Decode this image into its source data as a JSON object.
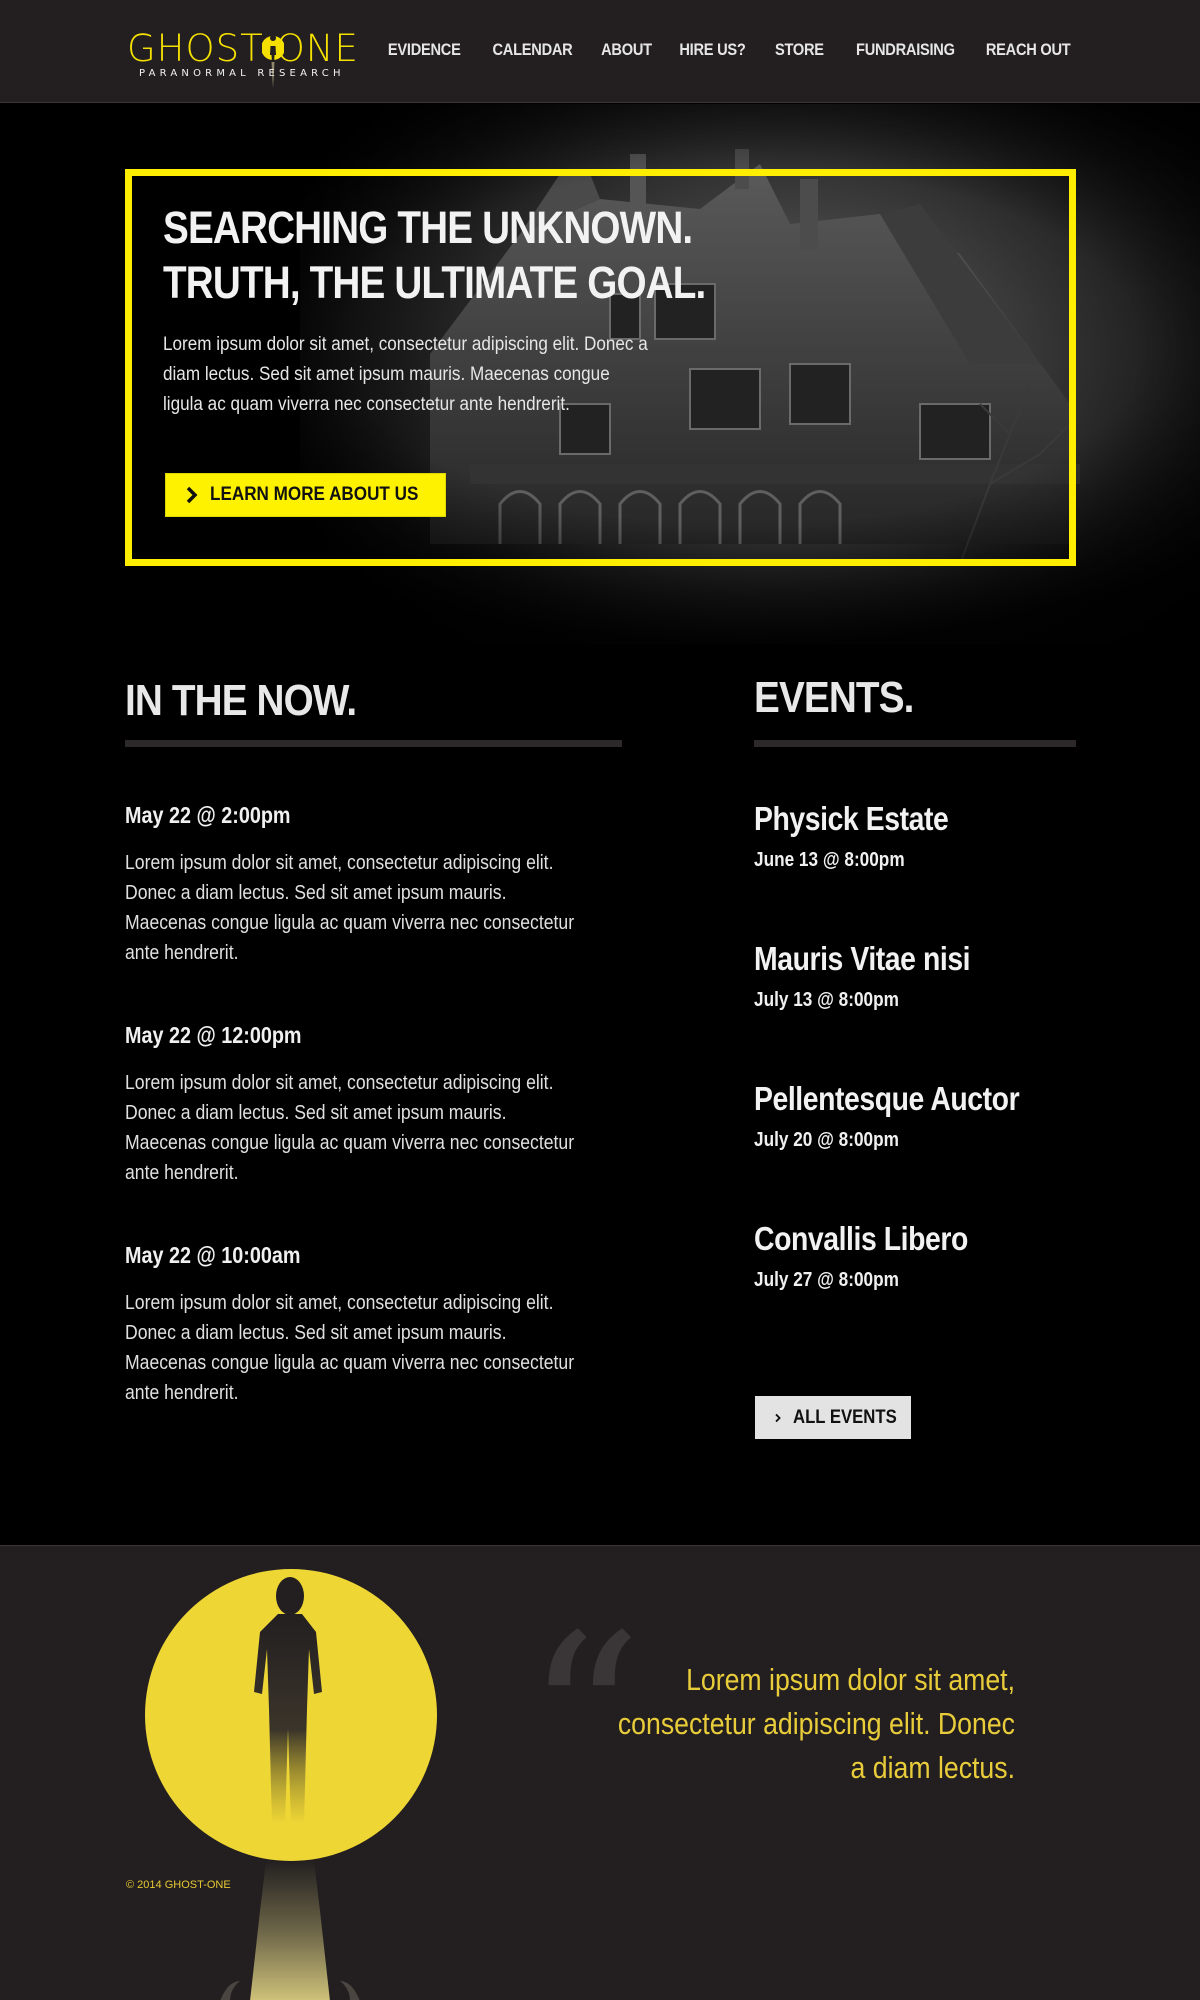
{
  "brand": {
    "name": "GHOST-ONE",
    "tagline": "PARANORMAL RESEARCH",
    "accent_color": "#fff200",
    "footer_moon_color": "#eed635",
    "background_color": "#000000",
    "bar_color": "#231f20"
  },
  "nav": {
    "items": [
      "EVIDENCE",
      "CALENDAR",
      "ABOUT",
      "HIRE US?",
      "STORE",
      "FUNDRAISING",
      "REACH OUT"
    ]
  },
  "hero": {
    "title_line1": "SEARCHING THE UNKNOWN.",
    "title_line2": "TRUTH, THE ULTIMATE GOAL.",
    "text": "Lorem ipsum dolor sit amet, consectetur adipiscing elit. Donec a diam lectus. Sed sit amet ipsum mauris. Maecenas congue ligula ac quam viverra nec consectetur ante hendrerit.",
    "button_label": "LEARN MORE  ABOUT US"
  },
  "now": {
    "title": "IN THE NOW.",
    "items": [
      {
        "date": "May 22 @ 2:00pm",
        "text": "Lorem ipsum dolor sit amet, consectetur adipiscing elit. Donec a diam lectus. Sed sit amet ipsum mauris. Maecenas congue ligula ac quam viverra nec consectetur ante hendrerit."
      },
      {
        "date": "May 22 @ 12:00pm",
        "text": "Lorem ipsum dolor sit amet, consectetur adipiscing elit. Donec a diam lectus. Sed sit amet ipsum mauris. Maecenas congue ligula ac quam viverra nec consectetur ante hendrerit."
      },
      {
        "date": "May 22 @ 10:00am",
        "text": "Lorem ipsum dolor sit amet, consectetur adipiscing elit. Donec a diam lectus. Sed sit amet ipsum mauris. Maecenas congue ligula ac quam viverra nec consectetur ante hendrerit."
      }
    ]
  },
  "events": {
    "title": "EVENTS.",
    "items": [
      {
        "name": "Physick Estate",
        "date": "June 13 @ 8:00pm"
      },
      {
        "name": "Mauris Vitae nisi",
        "date": "July 13 @ 8:00pm"
      },
      {
        "name": "Pellentesque Auctor",
        "date": "July 20 @ 8:00pm"
      },
      {
        "name": "Convallis Libero",
        "date": "July 27 @ 8:00pm"
      }
    ],
    "button_label": "ALL EVENTS"
  },
  "footer": {
    "quote": "Lorem ipsum dolor sit amet, consectetur adipiscing elit. Donec a diam lectus.",
    "copyright": "© 2014 GHOST-ONE"
  },
  "icons": {
    "button_chevron": "chevron-right-icon",
    "logo_pin": "ghost-pin-icon",
    "quote": "quote-mark-icon"
  }
}
